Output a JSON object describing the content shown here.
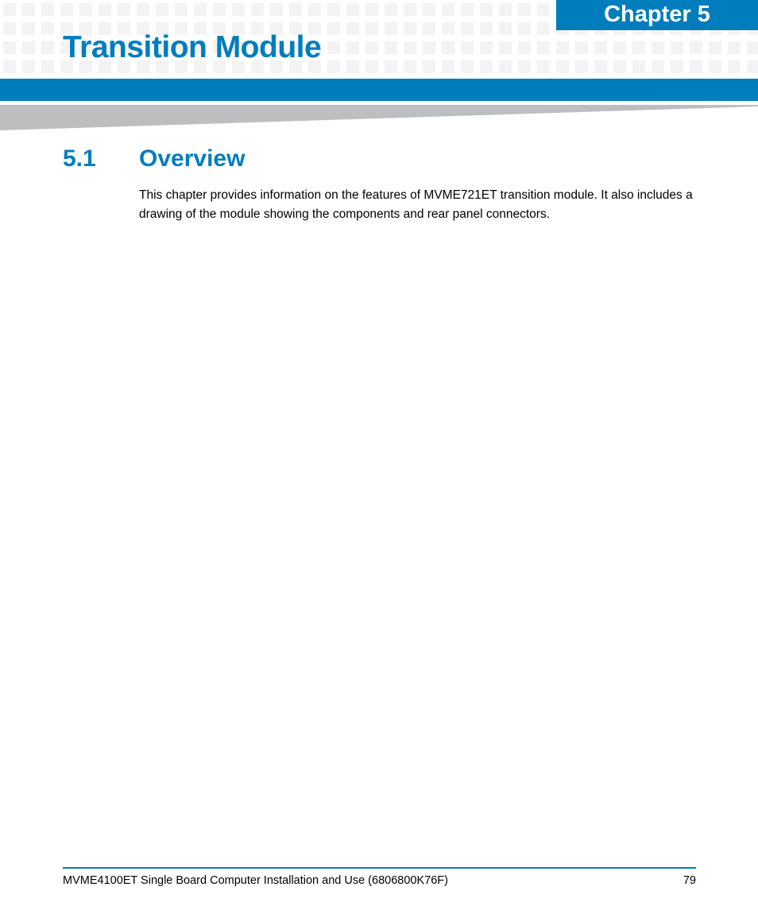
{
  "header": {
    "chapter_label": "Chapter 5",
    "title": "Transition Module",
    "accent_color": "#007dbc"
  },
  "section": {
    "number": "5.1",
    "title": "Overview",
    "paragraph": "This chapter provides information on the features of MVME721ET transition module. It also includes a drawing of the module showing the components and rear panel connectors."
  },
  "footer": {
    "document_title": "MVME4100ET Single Board Computer Installation and Use (6806800K76F)",
    "page_number": "79"
  }
}
